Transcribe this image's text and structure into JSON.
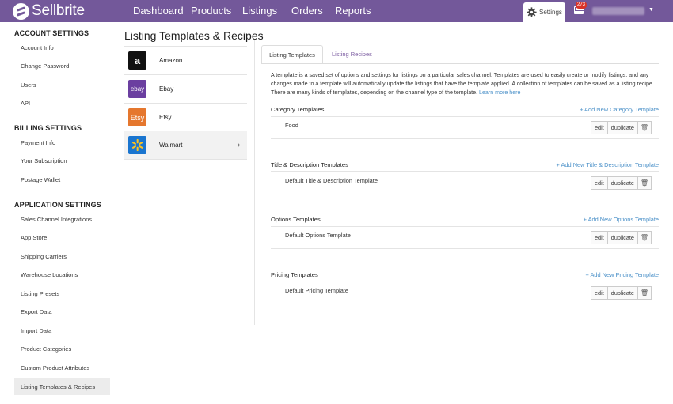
{
  "header": {
    "logo_text": "Sellbrite",
    "nav": [
      "Dashboard",
      "Products",
      "Listings",
      "Orders",
      "Reports"
    ],
    "settings_label": "Settings",
    "notification_count": "273",
    "brand_color": "#73589a"
  },
  "sidebar": {
    "account": {
      "heading": "ACCOUNT SETTINGS",
      "items": [
        "Account Info",
        "Change Password",
        "Users",
        "API"
      ]
    },
    "billing": {
      "heading": "BILLING SETTINGS",
      "items": [
        "Payment Info",
        "Your Subscription",
        "Postage Wallet"
      ]
    },
    "application": {
      "heading": "APPLICATION SETTINGS",
      "items": [
        "Sales Channel Integrations",
        "App Store",
        "Shipping Carriers",
        "Warehouse Locations",
        "Listing Presets",
        "Export Data",
        "Import Data",
        "Product Categories",
        "Custom Product Attributes",
        "Listing Templates & Recipes"
      ]
    },
    "active_item": "Listing Templates & Recipes"
  },
  "page_title": "Listing Templates & Recipes",
  "channels": [
    {
      "name": "Amazon",
      "logo": "amazon-logo",
      "color": "#111111"
    },
    {
      "name": "Ebay",
      "logo": "ebay-logo",
      "color": "#6b3fa0"
    },
    {
      "name": "Etsy",
      "logo": "etsy-logo",
      "color": "#e5772e"
    },
    {
      "name": "Walmart",
      "logo": "walmart-logo",
      "color": "#1a75cf",
      "selected": true
    }
  ],
  "tabs": {
    "templates": "Listing Templates",
    "recipes": "Listing Recipes"
  },
  "description": "A template is a saved set of options and settings for listings on a particular sales channel. Templates are used to easily create or modify listings, and any changes made to a template will automatically update the listings that have the template applied. A collection of templates can be saved as a listing recipe. There are many kinds of templates, depending on the channel type of the template.",
  "learn_more": "Learn more here",
  "buttons": {
    "edit": "edit",
    "duplicate": "duplicate"
  },
  "sections": [
    {
      "title": "Category Templates",
      "add_label": "+ Add New Category Template",
      "template": "Food"
    },
    {
      "title": "Title & Description Templates",
      "add_label": "+ Add New Title & Description Template",
      "template": "Default Title & Description Template"
    },
    {
      "title": "Options Templates",
      "add_label": "+ Add New Options Template",
      "template": "Default Options Template"
    },
    {
      "title": "Pricing Templates",
      "add_label": "+ Add New Pricing Template",
      "template": "Default Pricing Template"
    }
  ]
}
